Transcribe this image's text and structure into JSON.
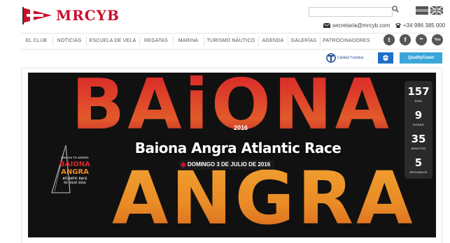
{
  "header": {
    "logo_text": "MRCYB",
    "search_placeholder": "",
    "search_icon": "search-icon",
    "languages": [
      "spanish-flag",
      "uk-flag"
    ],
    "email": "secretaria@mrcyb.com",
    "phone": "+34 986 385 000"
  },
  "nav": {
    "items": [
      "EL CLUB",
      "NOTICIAS",
      "ESCUELA DE VELA",
      "REGATAS",
      "MARINA",
      "TURISMO NÁUTICO",
      "AGENDA",
      "GALERÍAS",
      "PATROCINADORES"
    ],
    "social": [
      "twitter-icon",
      "facebook-icon",
      "flickr-icon",
      "youtube-icon"
    ],
    "social_glyphs": [
      "t",
      "f",
      "••",
      "You"
    ]
  },
  "badges": {
    "calidad": "Calidad Turística",
    "quality": "QualityCoast"
  },
  "hero": {
    "big_top": "BAiONA",
    "big_bottom": "ANGRA",
    "year": "2016",
    "title": "Baiona Angra Atlantic Race",
    "date": "DOMINGO 3 DE JULIO DE 2016",
    "countdown": [
      {
        "value": "157",
        "label": "DÍAS"
      },
      {
        "value": "9",
        "label": "HORAS"
      },
      {
        "value": "35",
        "label": "MINUTOS"
      },
      {
        "value": "5",
        "label": "SEGUNDOS"
      }
    ],
    "mini_logo": {
      "line1": "GALICIA TO AZORES",
      "line2": "BAIONA",
      "line3": "ANGRA",
      "line4": "ATLANTIC RACE",
      "line5": "03 JULIO 2016"
    }
  },
  "colors": {
    "brand": "#c8102e",
    "countdown_bg": "#2a2a2a"
  }
}
